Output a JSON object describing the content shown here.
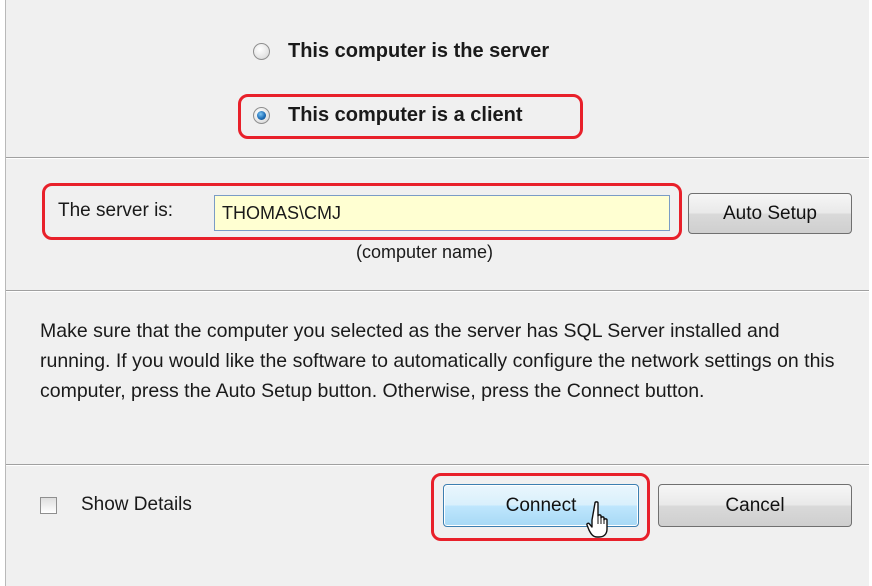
{
  "radio_options": {
    "server_label": "This computer is the server",
    "server_selected": false,
    "client_label": "This computer is a client",
    "client_selected": true
  },
  "server": {
    "label": "The server is:",
    "value": "THOMAS\\CMJ",
    "hint": "(computer name)",
    "auto_setup_label": "Auto Setup"
  },
  "message": "Make sure that the computer you selected as the server has SQL Server installed and running.  If you would like the software to automatically configure the network settings on this computer, press the Auto Setup button.  Otherwise, press the Connect button.",
  "footer": {
    "show_details_label": "Show Details",
    "show_details_checked": false,
    "connect_label": "Connect",
    "cancel_label": "Cancel"
  },
  "colors": {
    "highlight": "#e8202a",
    "input_background": "#ffffd2",
    "dialog_background": "#f0f0f0"
  }
}
